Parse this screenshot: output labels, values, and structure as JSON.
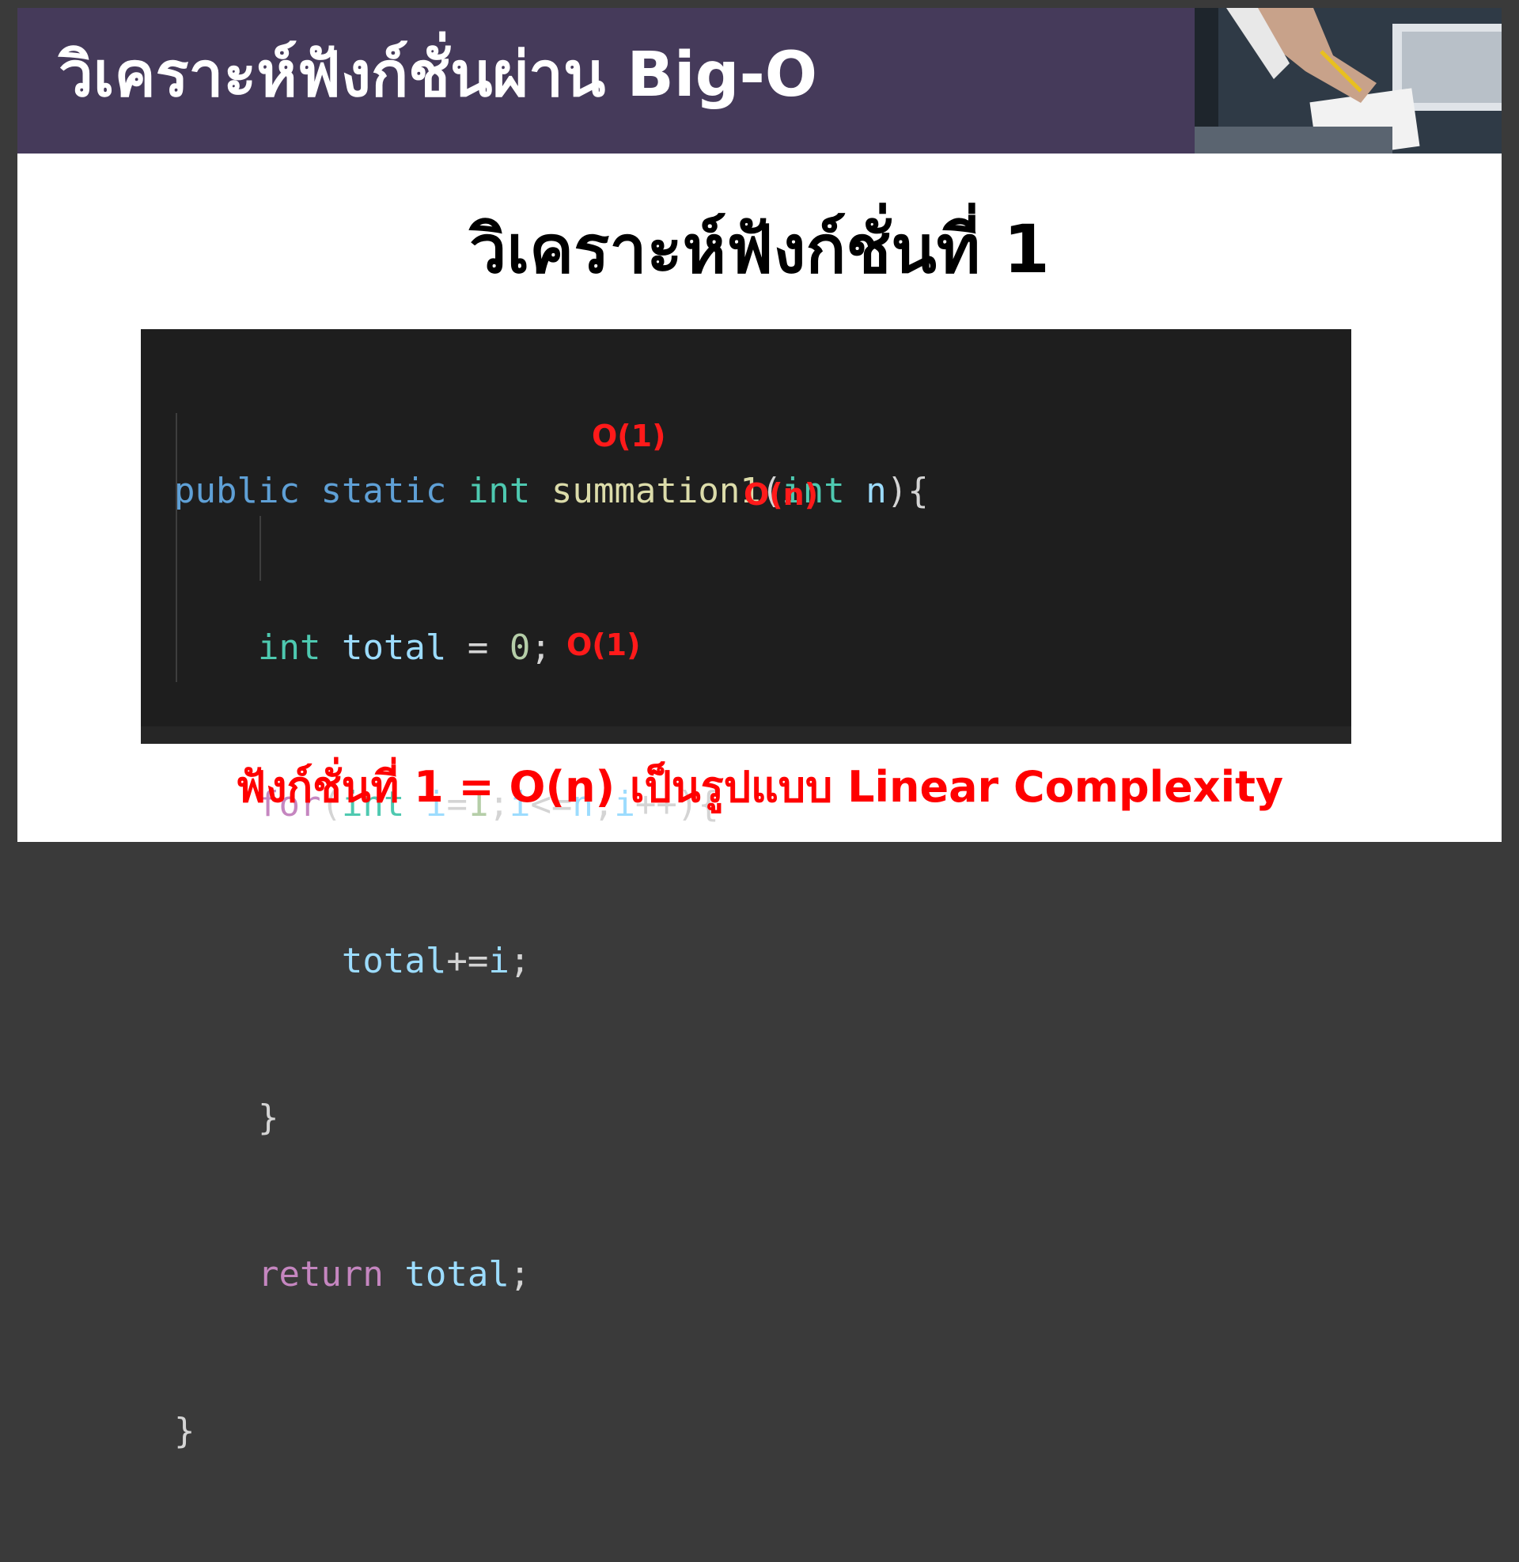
{
  "header": {
    "title": "วิเคราะห์ฟังก์ชั่นผ่าน Big-O",
    "photo_icon": "person-writing-photo"
  },
  "subtitle": "วิเคราะห์ฟังก์ชั่นที่ 1",
  "code": {
    "lines": [
      "public static int summation1(int n){",
      "    int total = 0;",
      "    for(int i=1;i<=n;i++){",
      "        total+=i;",
      "    }",
      "    return total;",
      "}"
    ],
    "annotations": {
      "line2": "O(1)",
      "line3": "O(n)",
      "line6": "O(1)"
    }
  },
  "footer": "ฟังก์ชั่นที่ 1 = O(n) เป็นรูปแบบ Linear Complexity",
  "colors": {
    "header_bg": "#453a5a",
    "code_bg": "#1e1e1e",
    "annotation": "#ff1a1a"
  }
}
